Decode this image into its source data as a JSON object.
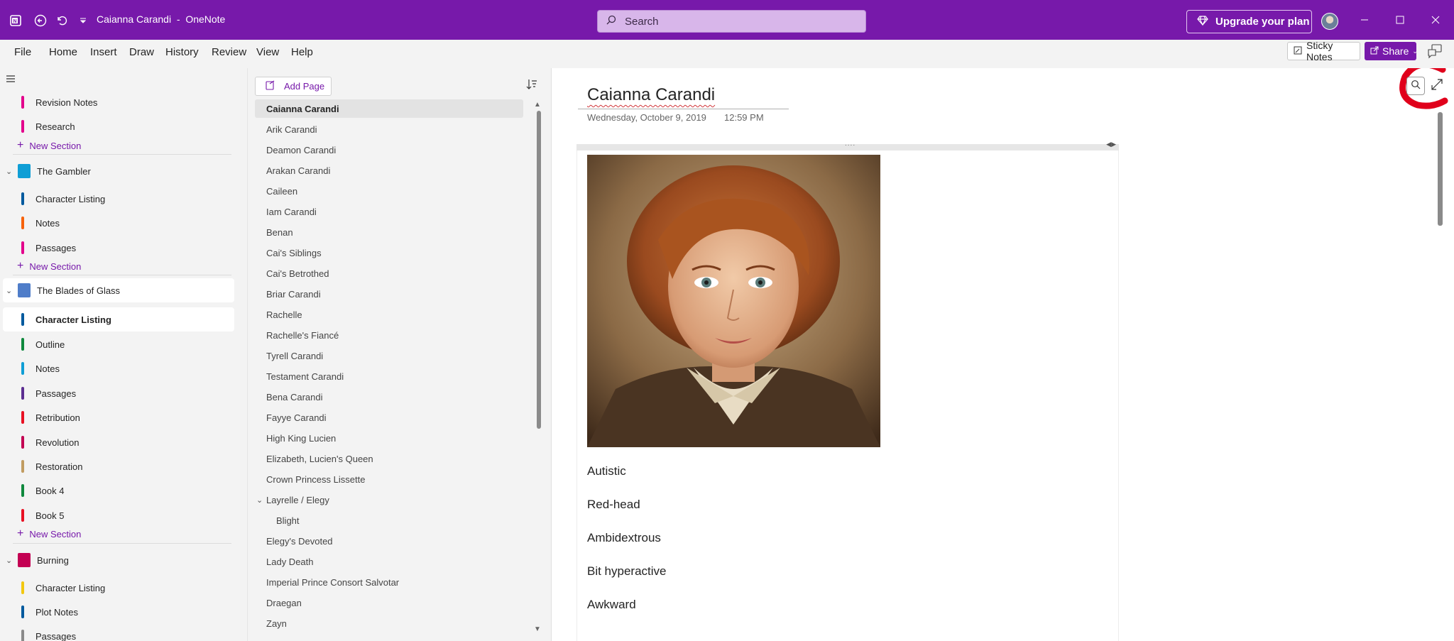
{
  "titlebar": {
    "title": "Caianna Carandi",
    "separator": "-",
    "app_name": "OneNote",
    "search_placeholder": "Search",
    "upgrade_label": "Upgrade your plan",
    "accent_color": "#7719aa"
  },
  "menubar": {
    "items": [
      "File",
      "Home",
      "Insert",
      "Draw",
      "History",
      "Review",
      "View",
      "Help"
    ],
    "sticky_notes_label": "Sticky Notes",
    "share_label": "Share"
  },
  "leftnav": {
    "top_sections": [
      {
        "label": "Revision Notes",
        "color": "#e3008c"
      },
      {
        "label": "Research",
        "color": "#e3008c"
      }
    ],
    "new_section_label": "New Section",
    "notebooks": [
      {
        "name": "The Gambler",
        "color": "#0f9ed5",
        "sections": [
          {
            "label": "Character Listing",
            "color": "#005a9e"
          },
          {
            "label": "Notes",
            "color": "#f7630c"
          },
          {
            "label": "Passages",
            "color": "#e3008c"
          }
        ]
      },
      {
        "name": "The Blades of Glass",
        "color": "#4f7dc9",
        "sections": [
          {
            "label": "Character Listing",
            "color": "#005a9e",
            "selected": true
          },
          {
            "label": "Outline",
            "color": "#10893e"
          },
          {
            "label": "Notes",
            "color": "#0f9ed5"
          },
          {
            "label": "Passages",
            "color": "#5c2e91"
          },
          {
            "label": "Retribution",
            "color": "#e81123"
          },
          {
            "label": "Revolution",
            "color": "#c30052"
          },
          {
            "label": "Restoration",
            "color": "#c19c61"
          },
          {
            "label": "Book 4",
            "color": "#10893e"
          },
          {
            "label": "Book 5",
            "color": "#e81123"
          }
        ]
      },
      {
        "name": "Burning",
        "color": "#c30052",
        "sections": [
          {
            "label": "Character Listing",
            "color": "#f2c811"
          },
          {
            "label": "Plot Notes",
            "color": "#005a9e"
          },
          {
            "label": "Passages",
            "color": "#8a8a8a"
          }
        ]
      }
    ]
  },
  "pagelist": {
    "add_page_label": "Add Page",
    "pages": [
      {
        "label": "Caianna Carandi",
        "selected": true
      },
      {
        "label": "Arik Carandi"
      },
      {
        "label": "Deamon Carandi"
      },
      {
        "label": "Arakan Carandi"
      },
      {
        "label": "Caileen"
      },
      {
        "label": "Iam Carandi"
      },
      {
        "label": "Benan"
      },
      {
        "label": "Cai's Siblings"
      },
      {
        "label": "Cai's Betrothed"
      },
      {
        "label": "Briar Carandi"
      },
      {
        "label": "Rachelle"
      },
      {
        "label": "Rachelle's Fiancé"
      },
      {
        "label": "Tyrell Carandi"
      },
      {
        "label": "Testament Carandi"
      },
      {
        "label": "Bena Carandi"
      },
      {
        "label": "Fayye Carandi"
      },
      {
        "label": "High King Lucien"
      },
      {
        "label": "Elizabeth, Lucien's Queen"
      },
      {
        "label": "Crown Princess Lissette"
      },
      {
        "label": "Layrelle / Elegy",
        "expanded": true
      },
      {
        "label": "Blight",
        "sub": true
      },
      {
        "label": "Elegy's Devoted"
      },
      {
        "label": "Lady Death"
      },
      {
        "label": "Imperial Prince Consort Salvotar"
      },
      {
        "label": "Draegan"
      },
      {
        "label": "Zayn"
      }
    ]
  },
  "page": {
    "title": "Caianna Carandi",
    "date": "Wednesday, October 9, 2019",
    "time": "12:59 PM",
    "image_alt": "Portrait of a red-haired young woman",
    "notes": [
      "Autistic",
      "Red-head",
      "Ambidextrous",
      "Bit hyperactive",
      "Awkward"
    ]
  }
}
